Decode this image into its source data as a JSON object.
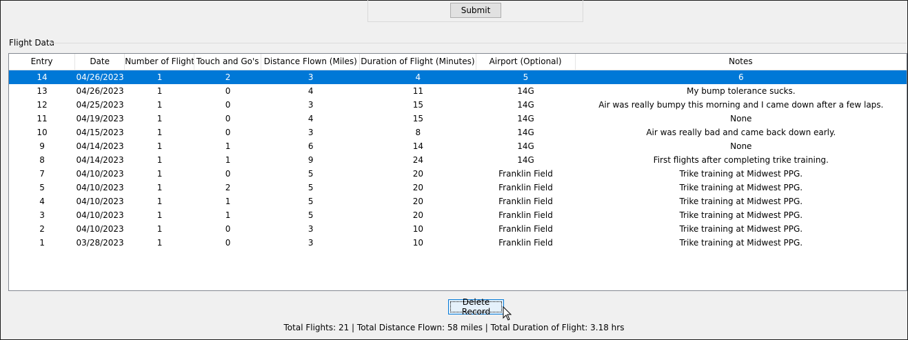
{
  "top": {
    "submit_label": "Submit"
  },
  "group": {
    "label": "Flight Data"
  },
  "table": {
    "columns": [
      "Entry",
      "Date",
      "Number of Flights",
      "Touch and Go's",
      "Distance Flown (Miles)",
      "Duration of Flight (Minutes)",
      "Airport (Optional)",
      "Notes"
    ],
    "selected_index": 0,
    "rows": [
      [
        "14",
        "04/26/2023",
        "1",
        "2",
        "3",
        "4",
        "5",
        "6"
      ],
      [
        "13",
        "04/26/2023",
        "1",
        "0",
        "4",
        "11",
        "14G",
        "My bump tolerance sucks."
      ],
      [
        "12",
        "04/25/2023",
        "1",
        "0",
        "3",
        "15",
        "14G",
        "Air was really bumpy this morning and I came down after a few laps."
      ],
      [
        "11",
        "04/19/2023",
        "1",
        "0",
        "4",
        "15",
        "14G",
        "None"
      ],
      [
        "10",
        "04/15/2023",
        "1",
        "0",
        "3",
        "8",
        "14G",
        "Air was really bad and came back down early."
      ],
      [
        "9",
        "04/14/2023",
        "1",
        "1",
        "6",
        "14",
        "14G",
        "None"
      ],
      [
        "8",
        "04/14/2023",
        "1",
        "1",
        "9",
        "24",
        "14G",
        "First flights after completing trike training."
      ],
      [
        "7",
        "04/10/2023",
        "1",
        "0",
        "5",
        "20",
        "Franklin Field",
        "Trike training at Midwest PPG."
      ],
      [
        "5",
        "04/10/2023",
        "1",
        "2",
        "5",
        "20",
        "Franklin Field",
        "Trike training at Midwest PPG."
      ],
      [
        "4",
        "04/10/2023",
        "1",
        "1",
        "5",
        "20",
        "Franklin Field",
        "Trike training at Midwest PPG."
      ],
      [
        "3",
        "04/10/2023",
        "1",
        "1",
        "5",
        "20",
        "Franklin Field",
        "Trike training at Midwest PPG."
      ],
      [
        "2",
        "04/10/2023",
        "1",
        "0",
        "3",
        "10",
        "Franklin Field",
        "Trike training at Midwest PPG."
      ],
      [
        "1",
        "03/28/2023",
        "1",
        "0",
        "3",
        "10",
        "Franklin Field",
        "Trike training at Midwest PPG."
      ]
    ]
  },
  "actions": {
    "delete_label": "Delete Record"
  },
  "totals": {
    "text": "Total Flights: 21 | Total Distance Flown: 58 miles | Total Duration of Flight: 3.18 hrs"
  },
  "colors": {
    "selection": "#0078d7",
    "window_bg": "#f0f0f0"
  },
  "icons": {
    "cursor": "mouse-pointer-icon"
  }
}
